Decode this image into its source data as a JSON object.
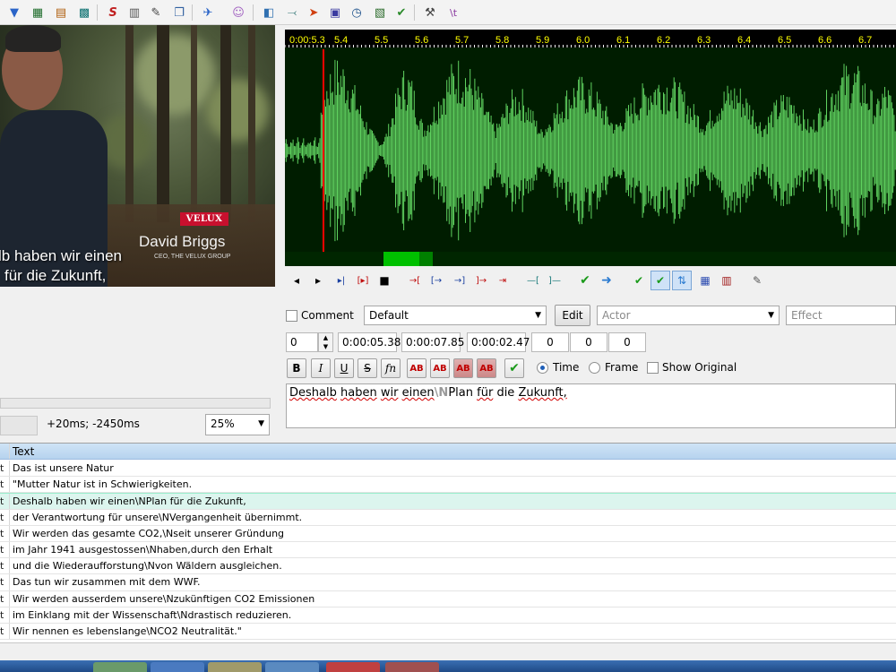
{
  "toolbar": {
    "icons": [
      "properties-icon",
      "styles-icon",
      "video-icon",
      "timing-icon",
      "font-icon",
      "notes-icon",
      "attach-icon",
      "copy-icon",
      "automation-icon",
      "avatar-icon",
      "split-icon",
      "link-icon",
      "fish-icon",
      "box-icon",
      "clock-icon",
      "zoom-icon",
      "check-icon",
      "tools-icon",
      "tag-icon"
    ]
  },
  "video": {
    "logo_text": "VELUX",
    "speaker_name": "David Briggs",
    "speaker_role": "CEO, THE VELUX GROUP",
    "subtitle_line1": "lb haben wir einen",
    "subtitle_line2": "für die Zukunft,"
  },
  "player": {
    "offset_text": "+20ms; -2450ms",
    "zoom": "25%"
  },
  "waveform": {
    "time_labels": [
      "0:00:5.3",
      "5.4",
      "5.5",
      "5.6",
      "5.7",
      "5.8",
      "5.9",
      "6.0",
      "6.1",
      "6.2",
      "6.3",
      "6.4",
      "6.5",
      "6.6",
      "6.7"
    ],
    "colors": {
      "wave": "#5fd15f",
      "bg": "#002200",
      "cursor": "#ff0000"
    }
  },
  "editor": {
    "comment_label": "Comment",
    "style": "Default",
    "edit_button": "Edit",
    "actor_placeholder": "Actor",
    "effect_placeholder": "Effect",
    "layer": "0",
    "start_time": "0:00:05.38",
    "end_time": "0:00:07.85",
    "duration": "0:00:02.47",
    "margin_left": "0",
    "margin_right": "0",
    "margin_vert": "0",
    "bold": "B",
    "italic": "I",
    "underline": "U",
    "strike": "S",
    "fn": "fn",
    "ab_label": "AB",
    "time_label": "Time",
    "frame_label": "Frame",
    "show_original_label": "Show Original",
    "text_words": [
      "Deshalb",
      "haben",
      "wir",
      "einen"
    ],
    "text_tag": "\\N",
    "text_rest_plan": "Plan",
    "text_rest_fuer": "für",
    "text_rest_die": "die",
    "text_rest_zukunft": "Zukunft,"
  },
  "grid": {
    "header_text": "Text",
    "rows": [
      {
        "a": "t",
        "text": "Das ist unsere Natur"
      },
      {
        "a": "t",
        "text": "\"Mutter Natur ist in Schwierigkeiten."
      },
      {
        "a": "t",
        "text": "Deshalb haben wir einen\\NPlan für die Zukunft,"
      },
      {
        "a": "t",
        "text": "der Verantwortung für unsere\\NVergangenheit übernimmt."
      },
      {
        "a": "t",
        "text": "Wir werden das gesamte CO2,\\Nseit unserer Gründung"
      },
      {
        "a": "t",
        "text": "im Jahr 1941 ausgestossen\\Nhaben,durch den Erhalt"
      },
      {
        "a": "t",
        "text": "und die Wiederaufforstung\\Nvon Wäldern ausgleichen."
      },
      {
        "a": "t",
        "text": "Das tun wir zusammen mit dem WWF."
      },
      {
        "a": "t",
        "text": "Wir werden ausserdem unsere\\Nzukünftigen CO2 Emissionen"
      },
      {
        "a": "t",
        "text": "im Einklang mit der Wissenschaft\\Ndrastisch reduzieren."
      },
      {
        "a": "t",
        "text": "Wir nennen es lebenslange\\NCO2 Neutralität.\""
      }
    ],
    "selected_index": 2
  }
}
